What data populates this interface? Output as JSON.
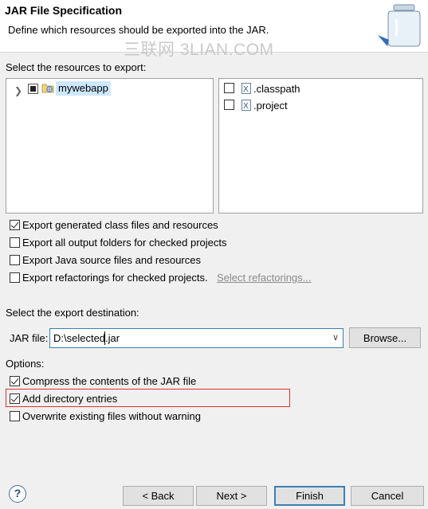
{
  "header": {
    "title": "JAR File Specification",
    "subtitle": "Define which resources should be exported into the JAR.",
    "watermark": "三联网 3LIAN.COM"
  },
  "resources": {
    "label": "Select the resources to export:",
    "tree": [
      {
        "label": "mywebapp",
        "state": "partial"
      }
    ],
    "files": [
      {
        "label": ".classpath",
        "checked": false
      },
      {
        "label": ".project",
        "checked": false
      }
    ]
  },
  "export_options": [
    {
      "label": "Export generated class files and resources",
      "checked": true
    },
    {
      "label": "Export all output folders for checked projects",
      "checked": false
    },
    {
      "label": "Export Java source files and resources",
      "checked": false
    },
    {
      "label": "Export refactorings for checked projects.",
      "checked": false
    }
  ],
  "select_refactorings_link": "Select refactorings...",
  "destination": {
    "label": "Select the export destination:",
    "jar_file_label": "JAR file:",
    "jar_file_value": "D:\\selected.jar",
    "browse_label": "Browse..."
  },
  "options": {
    "label": "Options:",
    "items": [
      {
        "label": "Compress the contents of the JAR file",
        "checked": true
      },
      {
        "label": "Add directory entries",
        "checked": true
      },
      {
        "label": "Overwrite existing files without warning",
        "checked": false
      }
    ]
  },
  "buttons": {
    "help": "?",
    "back": "< Back",
    "next": "Next >",
    "finish": "Finish",
    "cancel": "Cancel"
  },
  "colors": {
    "highlight_box": "#e03030",
    "selection": "#cde8ff",
    "focus_border": "#3c7fb1"
  }
}
